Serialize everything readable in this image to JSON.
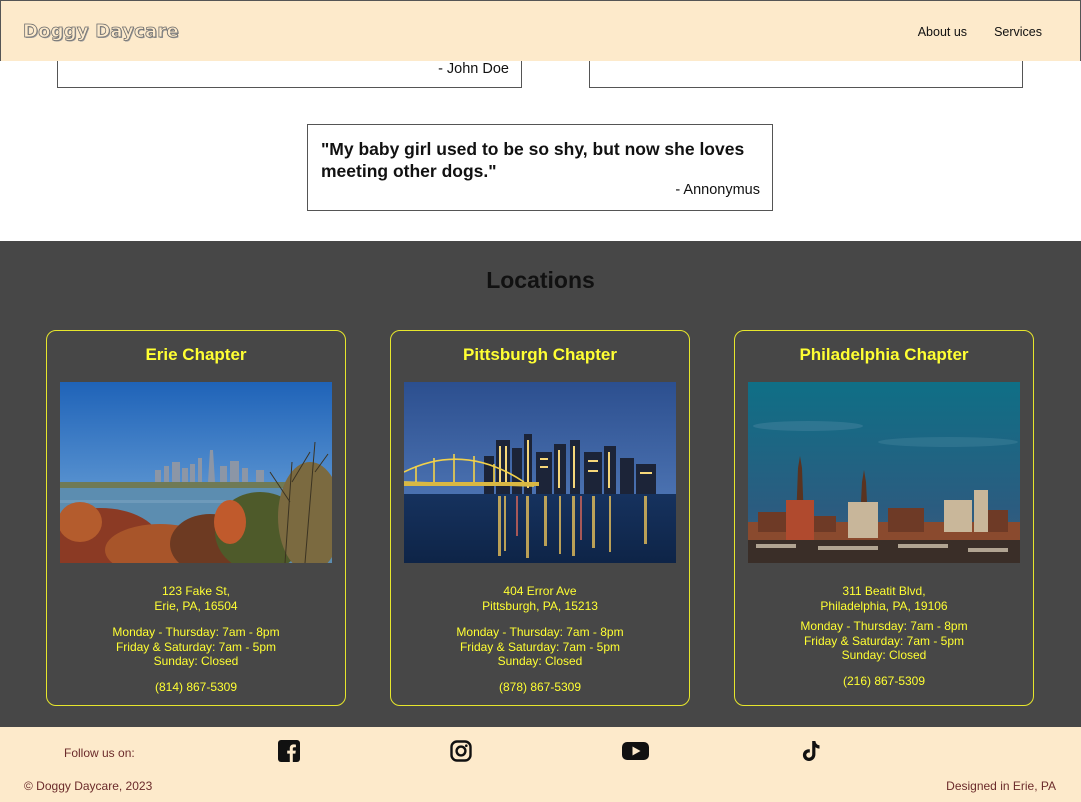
{
  "header": {
    "logo": "Doggy Daycare",
    "nav": [
      "About us",
      "Services"
    ]
  },
  "testimonials": [
    {
      "quote": "",
      "author": "- John Doe"
    },
    {
      "quote": "",
      "author": ""
    },
    {
      "quote": "\"My baby girl used to be so shy, but now she loves meeting other dogs.\"",
      "author": "- Annonymus"
    }
  ],
  "locations": {
    "title": "Locations",
    "cards": [
      {
        "name": "Erie Chapter",
        "address1": "123 Fake St,",
        "address2": "Erie, PA, 16504",
        "hours1": "Monday - Thursday: 7am - 8pm",
        "hours2": "Friday & Saturday: 7am - 5pm",
        "hours3": "Sunday: Closed",
        "phone": "(814) 867-5309"
      },
      {
        "name": "Pittsburgh Chapter",
        "address1": "404 Error Ave",
        "address2": "Pittsburgh, PA, 15213",
        "hours1": "Monday - Thursday: 7am - 8pm",
        "hours2": "Friday & Saturday: 7am - 5pm",
        "hours3": "Sunday: Closed",
        "phone": "(878) 867-5309"
      },
      {
        "name": "Philadelphia Chapter",
        "address1": "311 Beatit Blvd,",
        "address2": "Philadelphia, PA, 19106",
        "hours1": "Monday - Thursday: 7am - 8pm",
        "hours2": "Friday & Saturday: 7am - 5pm",
        "hours3": "Sunday: Closed",
        "phone": "(216) 867-5309"
      }
    ]
  },
  "footer": {
    "follow_label": "Follow us on:",
    "social": [
      "facebook-icon",
      "instagram-icon",
      "youtube-icon",
      "tiktok-icon"
    ],
    "copyright": "© Doggy Daycare, 2023",
    "designed": "Designed in Erie, PA"
  },
  "colors": {
    "header_bg": "#fdeacb",
    "locations_bg": "#474747",
    "accent": "#ffff33",
    "footer_text": "#6b2b2b"
  }
}
